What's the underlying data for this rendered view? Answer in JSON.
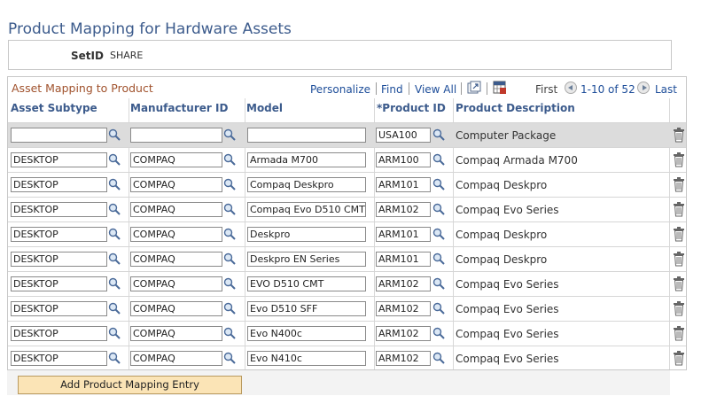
{
  "page": {
    "title": "Product Mapping for Hardware Assets"
  },
  "setid": {
    "label": "SetID",
    "value": "SHARE"
  },
  "grid": {
    "title": "Asset Mapping to Product",
    "personalize": "Personalize",
    "find": "Find",
    "view_all": "View All",
    "first": "First",
    "range": "1-10 of 52",
    "last": "Last",
    "columns": {
      "asset_subtype": "Asset Subtype",
      "manufacturer_id": "Manufacturer ID",
      "model": "Model",
      "product_id": "*Product ID",
      "product_description": "Product Description"
    },
    "rows": [
      {
        "asset_subtype": "",
        "manufacturer_id": "",
        "model": "",
        "product_id": "USA100",
        "product_description": "Computer Package"
      },
      {
        "asset_subtype": "DESKTOP",
        "manufacturer_id": "COMPAQ",
        "model": "Armada M700",
        "product_id": "ARM100",
        "product_description": "Compaq Armada M700"
      },
      {
        "asset_subtype": "DESKTOP",
        "manufacturer_id": "COMPAQ",
        "model": "Compaq Deskpro",
        "product_id": "ARM101",
        "product_description": "Compaq Deskpro"
      },
      {
        "asset_subtype": "DESKTOP",
        "manufacturer_id": "COMPAQ",
        "model": "Compaq Evo D510 CMT",
        "product_id": "ARM102",
        "product_description": "Compaq Evo Series"
      },
      {
        "asset_subtype": "DESKTOP",
        "manufacturer_id": "COMPAQ",
        "model": "Deskpro",
        "product_id": "ARM101",
        "product_description": "Compaq Deskpro"
      },
      {
        "asset_subtype": "DESKTOP",
        "manufacturer_id": "COMPAQ",
        "model": "Deskpro EN Series",
        "product_id": "ARM101",
        "product_description": "Compaq Deskpro"
      },
      {
        "asset_subtype": "DESKTOP",
        "manufacturer_id": "COMPAQ",
        "model": "EVO D510 CMT",
        "product_id": "ARM102",
        "product_description": "Compaq Evo Series"
      },
      {
        "asset_subtype": "DESKTOP",
        "manufacturer_id": "COMPAQ",
        "model": "Evo D510 SFF",
        "product_id": "ARM102",
        "product_description": "Compaq Evo Series"
      },
      {
        "asset_subtype": "DESKTOP",
        "manufacturer_id": "COMPAQ",
        "model": "Evo N400c",
        "product_id": "ARM102",
        "product_description": "Compaq Evo Series"
      },
      {
        "asset_subtype": "DESKTOP",
        "manufacturer_id": "COMPAQ",
        "model": "Evo N410c",
        "product_id": "ARM102",
        "product_description": "Compaq Evo Series"
      }
    ]
  },
  "actions": {
    "add_label": "Add Product Mapping Entry"
  },
  "colors": {
    "title_blue": "#3c5b8c",
    "grid_title_brown": "#a0522d",
    "link_blue": "#1d4d99",
    "button_bg": "#fbe4b6"
  },
  "icons": {
    "lookup": "magnifier-icon",
    "delete": "trash-icon",
    "zoom": "zoom-grid-icon",
    "download": "download-excel-icon"
  }
}
